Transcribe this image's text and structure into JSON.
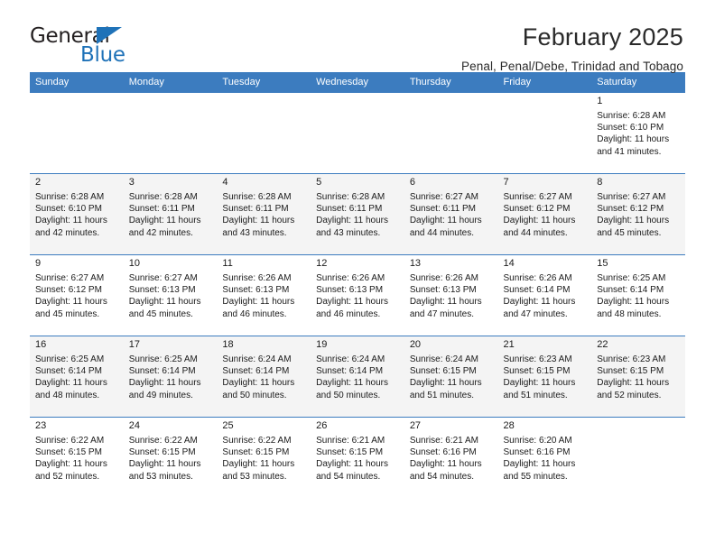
{
  "brand": {
    "name_top": "General",
    "name_bottom": "Blue",
    "accent_color": "#1f72b8"
  },
  "header": {
    "title": "February 2025",
    "subtitle": "Penal, Penal/Debe, Trinidad and Tobago"
  },
  "calendar": {
    "header_bg": "#3c7cbf",
    "alt_row_bg": "#f4f4f4",
    "weekdays": [
      "Sunday",
      "Monday",
      "Tuesday",
      "Wednesday",
      "Thursday",
      "Friday",
      "Saturday"
    ],
    "weeks": [
      [
        {
          "day": ""
        },
        {
          "day": ""
        },
        {
          "day": ""
        },
        {
          "day": ""
        },
        {
          "day": ""
        },
        {
          "day": ""
        },
        {
          "day": "1",
          "sunrise": "Sunrise: 6:28 AM",
          "sunset": "Sunset: 6:10 PM",
          "daylight": "Daylight: 11 hours and 41 minutes."
        }
      ],
      [
        {
          "day": "2",
          "sunrise": "Sunrise: 6:28 AM",
          "sunset": "Sunset: 6:10 PM",
          "daylight": "Daylight: 11 hours and 42 minutes."
        },
        {
          "day": "3",
          "sunrise": "Sunrise: 6:28 AM",
          "sunset": "Sunset: 6:11 PM",
          "daylight": "Daylight: 11 hours and 42 minutes."
        },
        {
          "day": "4",
          "sunrise": "Sunrise: 6:28 AM",
          "sunset": "Sunset: 6:11 PM",
          "daylight": "Daylight: 11 hours and 43 minutes."
        },
        {
          "day": "5",
          "sunrise": "Sunrise: 6:28 AM",
          "sunset": "Sunset: 6:11 PM",
          "daylight": "Daylight: 11 hours and 43 minutes."
        },
        {
          "day": "6",
          "sunrise": "Sunrise: 6:27 AM",
          "sunset": "Sunset: 6:11 PM",
          "daylight": "Daylight: 11 hours and 44 minutes."
        },
        {
          "day": "7",
          "sunrise": "Sunrise: 6:27 AM",
          "sunset": "Sunset: 6:12 PM",
          "daylight": "Daylight: 11 hours and 44 minutes."
        },
        {
          "day": "8",
          "sunrise": "Sunrise: 6:27 AM",
          "sunset": "Sunset: 6:12 PM",
          "daylight": "Daylight: 11 hours and 45 minutes."
        }
      ],
      [
        {
          "day": "9",
          "sunrise": "Sunrise: 6:27 AM",
          "sunset": "Sunset: 6:12 PM",
          "daylight": "Daylight: 11 hours and 45 minutes."
        },
        {
          "day": "10",
          "sunrise": "Sunrise: 6:27 AM",
          "sunset": "Sunset: 6:13 PM",
          "daylight": "Daylight: 11 hours and 45 minutes."
        },
        {
          "day": "11",
          "sunrise": "Sunrise: 6:26 AM",
          "sunset": "Sunset: 6:13 PM",
          "daylight": "Daylight: 11 hours and 46 minutes."
        },
        {
          "day": "12",
          "sunrise": "Sunrise: 6:26 AM",
          "sunset": "Sunset: 6:13 PM",
          "daylight": "Daylight: 11 hours and 46 minutes."
        },
        {
          "day": "13",
          "sunrise": "Sunrise: 6:26 AM",
          "sunset": "Sunset: 6:13 PM",
          "daylight": "Daylight: 11 hours and 47 minutes."
        },
        {
          "day": "14",
          "sunrise": "Sunrise: 6:26 AM",
          "sunset": "Sunset: 6:14 PM",
          "daylight": "Daylight: 11 hours and 47 minutes."
        },
        {
          "day": "15",
          "sunrise": "Sunrise: 6:25 AM",
          "sunset": "Sunset: 6:14 PM",
          "daylight": "Daylight: 11 hours and 48 minutes."
        }
      ],
      [
        {
          "day": "16",
          "sunrise": "Sunrise: 6:25 AM",
          "sunset": "Sunset: 6:14 PM",
          "daylight": "Daylight: 11 hours and 48 minutes."
        },
        {
          "day": "17",
          "sunrise": "Sunrise: 6:25 AM",
          "sunset": "Sunset: 6:14 PM",
          "daylight": "Daylight: 11 hours and 49 minutes."
        },
        {
          "day": "18",
          "sunrise": "Sunrise: 6:24 AM",
          "sunset": "Sunset: 6:14 PM",
          "daylight": "Daylight: 11 hours and 50 minutes."
        },
        {
          "day": "19",
          "sunrise": "Sunrise: 6:24 AM",
          "sunset": "Sunset: 6:14 PM",
          "daylight": "Daylight: 11 hours and 50 minutes."
        },
        {
          "day": "20",
          "sunrise": "Sunrise: 6:24 AM",
          "sunset": "Sunset: 6:15 PM",
          "daylight": "Daylight: 11 hours and 51 minutes."
        },
        {
          "day": "21",
          "sunrise": "Sunrise: 6:23 AM",
          "sunset": "Sunset: 6:15 PM",
          "daylight": "Daylight: 11 hours and 51 minutes."
        },
        {
          "day": "22",
          "sunrise": "Sunrise: 6:23 AM",
          "sunset": "Sunset: 6:15 PM",
          "daylight": "Daylight: 11 hours and 52 minutes."
        }
      ],
      [
        {
          "day": "23",
          "sunrise": "Sunrise: 6:22 AM",
          "sunset": "Sunset: 6:15 PM",
          "daylight": "Daylight: 11 hours and 52 minutes."
        },
        {
          "day": "24",
          "sunrise": "Sunrise: 6:22 AM",
          "sunset": "Sunset: 6:15 PM",
          "daylight": "Daylight: 11 hours and 53 minutes."
        },
        {
          "day": "25",
          "sunrise": "Sunrise: 6:22 AM",
          "sunset": "Sunset: 6:15 PM",
          "daylight": "Daylight: 11 hours and 53 minutes."
        },
        {
          "day": "26",
          "sunrise": "Sunrise: 6:21 AM",
          "sunset": "Sunset: 6:15 PM",
          "daylight": "Daylight: 11 hours and 54 minutes."
        },
        {
          "day": "27",
          "sunrise": "Sunrise: 6:21 AM",
          "sunset": "Sunset: 6:16 PM",
          "daylight": "Daylight: 11 hours and 54 minutes."
        },
        {
          "day": "28",
          "sunrise": "Sunrise: 6:20 AM",
          "sunset": "Sunset: 6:16 PM",
          "daylight": "Daylight: 11 hours and 55 minutes."
        },
        {
          "day": ""
        }
      ]
    ]
  }
}
